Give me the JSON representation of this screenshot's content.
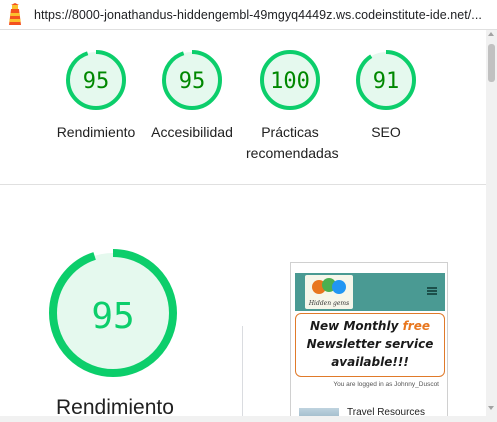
{
  "browser": {
    "url": "https://8000-jonathandus-hiddengembl-49mgyq4449z.ws.codeinstitute-ide.net/..."
  },
  "scores": [
    {
      "label": "Rendimiento",
      "value": "95",
      "score": 95
    },
    {
      "label": "Accesibilidad",
      "value": "95",
      "score": 95
    },
    {
      "label": "Prácticas recomendadas",
      "value": "100",
      "score": 100
    },
    {
      "label": "SEO",
      "value": "91",
      "score": 91
    }
  ],
  "main": {
    "category_label": "Rendimiento",
    "score_value": "95",
    "score": 95
  },
  "thumbnail": {
    "logo_text": "Hidden gems",
    "newsletter_line1": "New Monthly ",
    "newsletter_free": "free",
    "newsletter_line2": "Newsletter service",
    "newsletter_line3": "available!!!",
    "logged_in_text": "You are logged in as Johnny_Duscot",
    "travel_link": "Travel Resources"
  },
  "colors": {
    "pass": "#0cce6b",
    "pass_fill": "#e5f9ee",
    "pass_text": "#008800",
    "accent_orange": "#e8761e",
    "header_teal": "#4a9a93"
  }
}
